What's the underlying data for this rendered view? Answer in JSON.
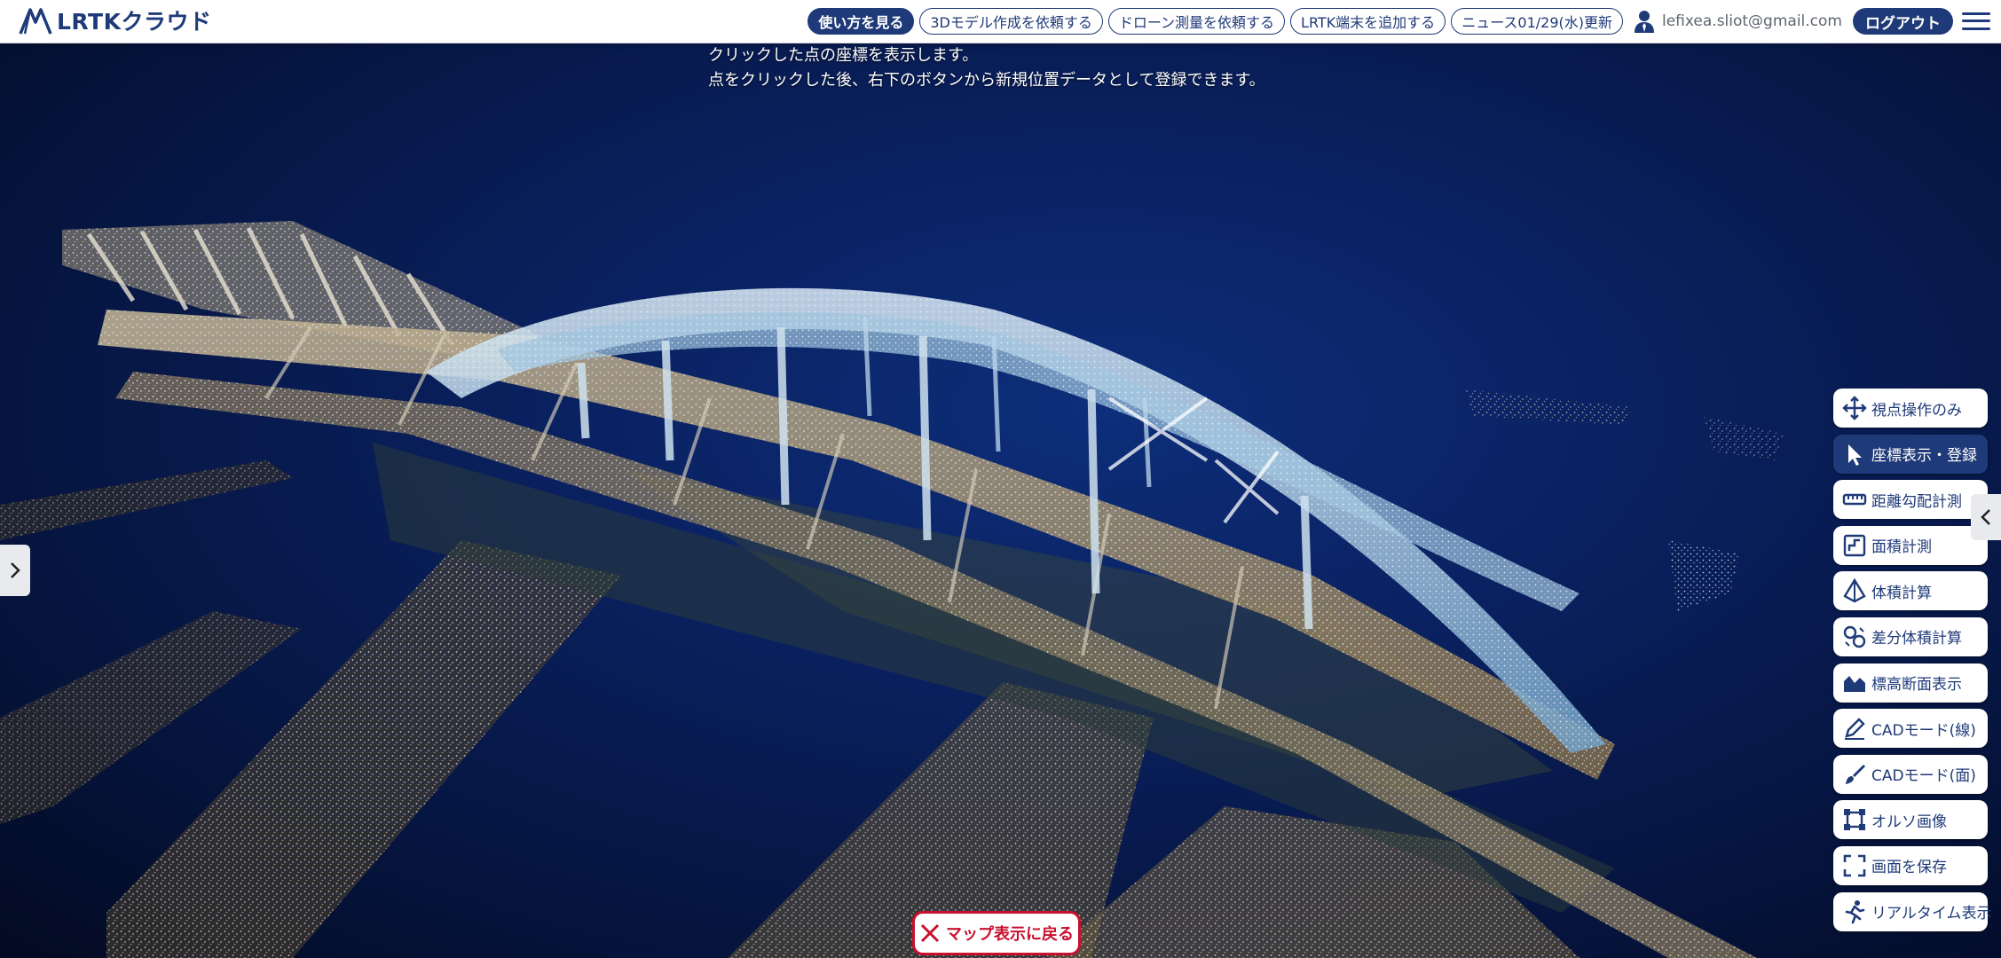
{
  "header": {
    "logo_text": "LRTKクラウド",
    "buttons": [
      {
        "label": "使い方を見る",
        "style": "primary"
      },
      {
        "label": "3Dモデル作成を依頼する",
        "style": "outline"
      },
      {
        "label": "ドローン測量を依頼する",
        "style": "outline"
      },
      {
        "label": "LRTK端末を追加する",
        "style": "outline"
      },
      {
        "label": "ニュース01/29(水)更新",
        "style": "outline"
      }
    ],
    "user_email": "lefixea.sliot@gmail.com",
    "logout_label": "ログアウト"
  },
  "viewer": {
    "instructions": [
      "クリックした点の座標を表示します。",
      "点をクリックした後、右下のボタンから新規位置データとして登録できます。"
    ]
  },
  "tools": [
    {
      "label": "視点操作のみ",
      "icon": "move-icon",
      "active": false
    },
    {
      "label": "座標表示・登録",
      "icon": "cursor-icon",
      "active": true
    },
    {
      "label": "距離勾配計測",
      "icon": "ruler-icon",
      "active": false
    },
    {
      "label": "面積計測",
      "icon": "area-icon",
      "active": false
    },
    {
      "label": "体積計算",
      "icon": "volume-icon",
      "active": false
    },
    {
      "label": "差分体積計算",
      "icon": "diff-volume-icon",
      "active": false
    },
    {
      "label": "標高断面表示",
      "icon": "elevation-icon",
      "active": false
    },
    {
      "label": "CADモード(線)",
      "icon": "pencil-icon",
      "active": false
    },
    {
      "label": "CADモード(面)",
      "icon": "brush-icon",
      "active": false
    },
    {
      "label": "オルソ画像",
      "icon": "ortho-icon",
      "active": false
    },
    {
      "label": "画面を保存",
      "icon": "capture-icon",
      "active": false
    },
    {
      "label": "リアルタイム表示",
      "icon": "runner-icon",
      "active": false
    }
  ],
  "back_button_label": "マップ表示に戻る",
  "colors": {
    "brand": "#1f3a78",
    "danger": "#c8102e",
    "viewer_bg": "#0a2160"
  }
}
